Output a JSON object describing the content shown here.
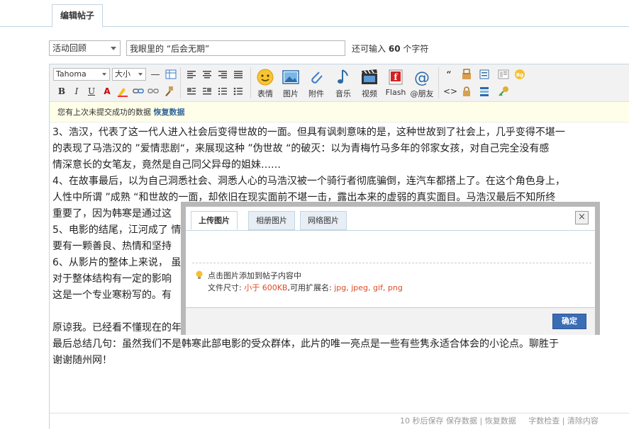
{
  "tabs": {
    "edit_post": "编辑帖子"
  },
  "subject": {
    "type_selected": "活动回顾",
    "title_value": "我眼里的 “后会无期”",
    "hint_prefix": "还可输入",
    "hint_count": "60",
    "hint_suffix": "个字符"
  },
  "toolbar": {
    "font_family": "Tahoma",
    "font_size": "大小",
    "buttons": {
      "emoji": "表情",
      "image": "图片",
      "attach": "附件",
      "music": "音乐",
      "video": "视频",
      "flash": "Flash",
      "at_friend": "@朋友"
    }
  },
  "notice": {
    "text": "您有上次未提交成功的数据",
    "restore_link": "恢复数据"
  },
  "content": {
    "lines": [
      "3、浩汉，代表了这一代人进入社会后变得世故的一面。但具有讽刺意味的是，这种世故到了社会上，几乎变得不堪一",
      "的表现了马浩汉的 ”爱情悲剧“，来展现这种 ”伪世故 “的破灭：以为青梅竹马多年的邻家女孩，对自己完全没有感",
      "情深意长的女笔友，竟然是自己同父异母的姐妹……",
      "4、在故事最后，以为自己洞悉社会、洞悉人心的马浩汉被一个骑行者彻底骗倒，连汽车都搭上了。在这个角色身上，",
      "人性中所谓 ”成熟 “和世故的一面，却依旧在现实面前不堪一击，露出本来的虚弱的真实面目。马浩汉最后不知所终",
      "重要了，因为韩寒是通过这",
      "5、电影的结尾，江河成了                                                                                      情况下，",
      "要有一颗善良、热情和坚持",
      "6、从影片的整体上来说，                                                                                      虽然影片",
      "对于整体结构有一定的影响",
      "这是一个专业寒粉写的。有",
      "",
      "原谅我。已经看不懂现在的年轻，我们这个年纪只会另类解读头脑，没有一样有着忠诚，对于人往往总 写着一眼就",
      "最后总结几句：虽然我们不是韩寒此部电影的受众群体，此片的唯一亮点是一些有些隽永适合体会的小论点。聊胜于",
      "谢谢随州网！"
    ]
  },
  "statusbar": {
    "autosave": "10 秒后保存",
    "save_data": "保存数据",
    "restore_data": "恢复数据",
    "word_check": "字数检查",
    "clear_content": "清除内容"
  },
  "dialog": {
    "tabs": [
      "上传图片",
      "相册图片",
      "网络图片"
    ],
    "close_glyph": "×",
    "tip_line1": "点击图片添加到帖子内容中",
    "size_label": "文件尺寸:",
    "size_value": "小于 600KB",
    "ext_label": ",可用扩展名:",
    "ext_value": "jpg, jpeg, gif, png",
    "ok_label": "确定"
  },
  "colors": {
    "accent_blue": "#3a6db5",
    "border_blue": "#c2d5e3",
    "link_blue": "#336699",
    "notice_bg": "#fefee9",
    "warning_red": "#e04b25"
  }
}
